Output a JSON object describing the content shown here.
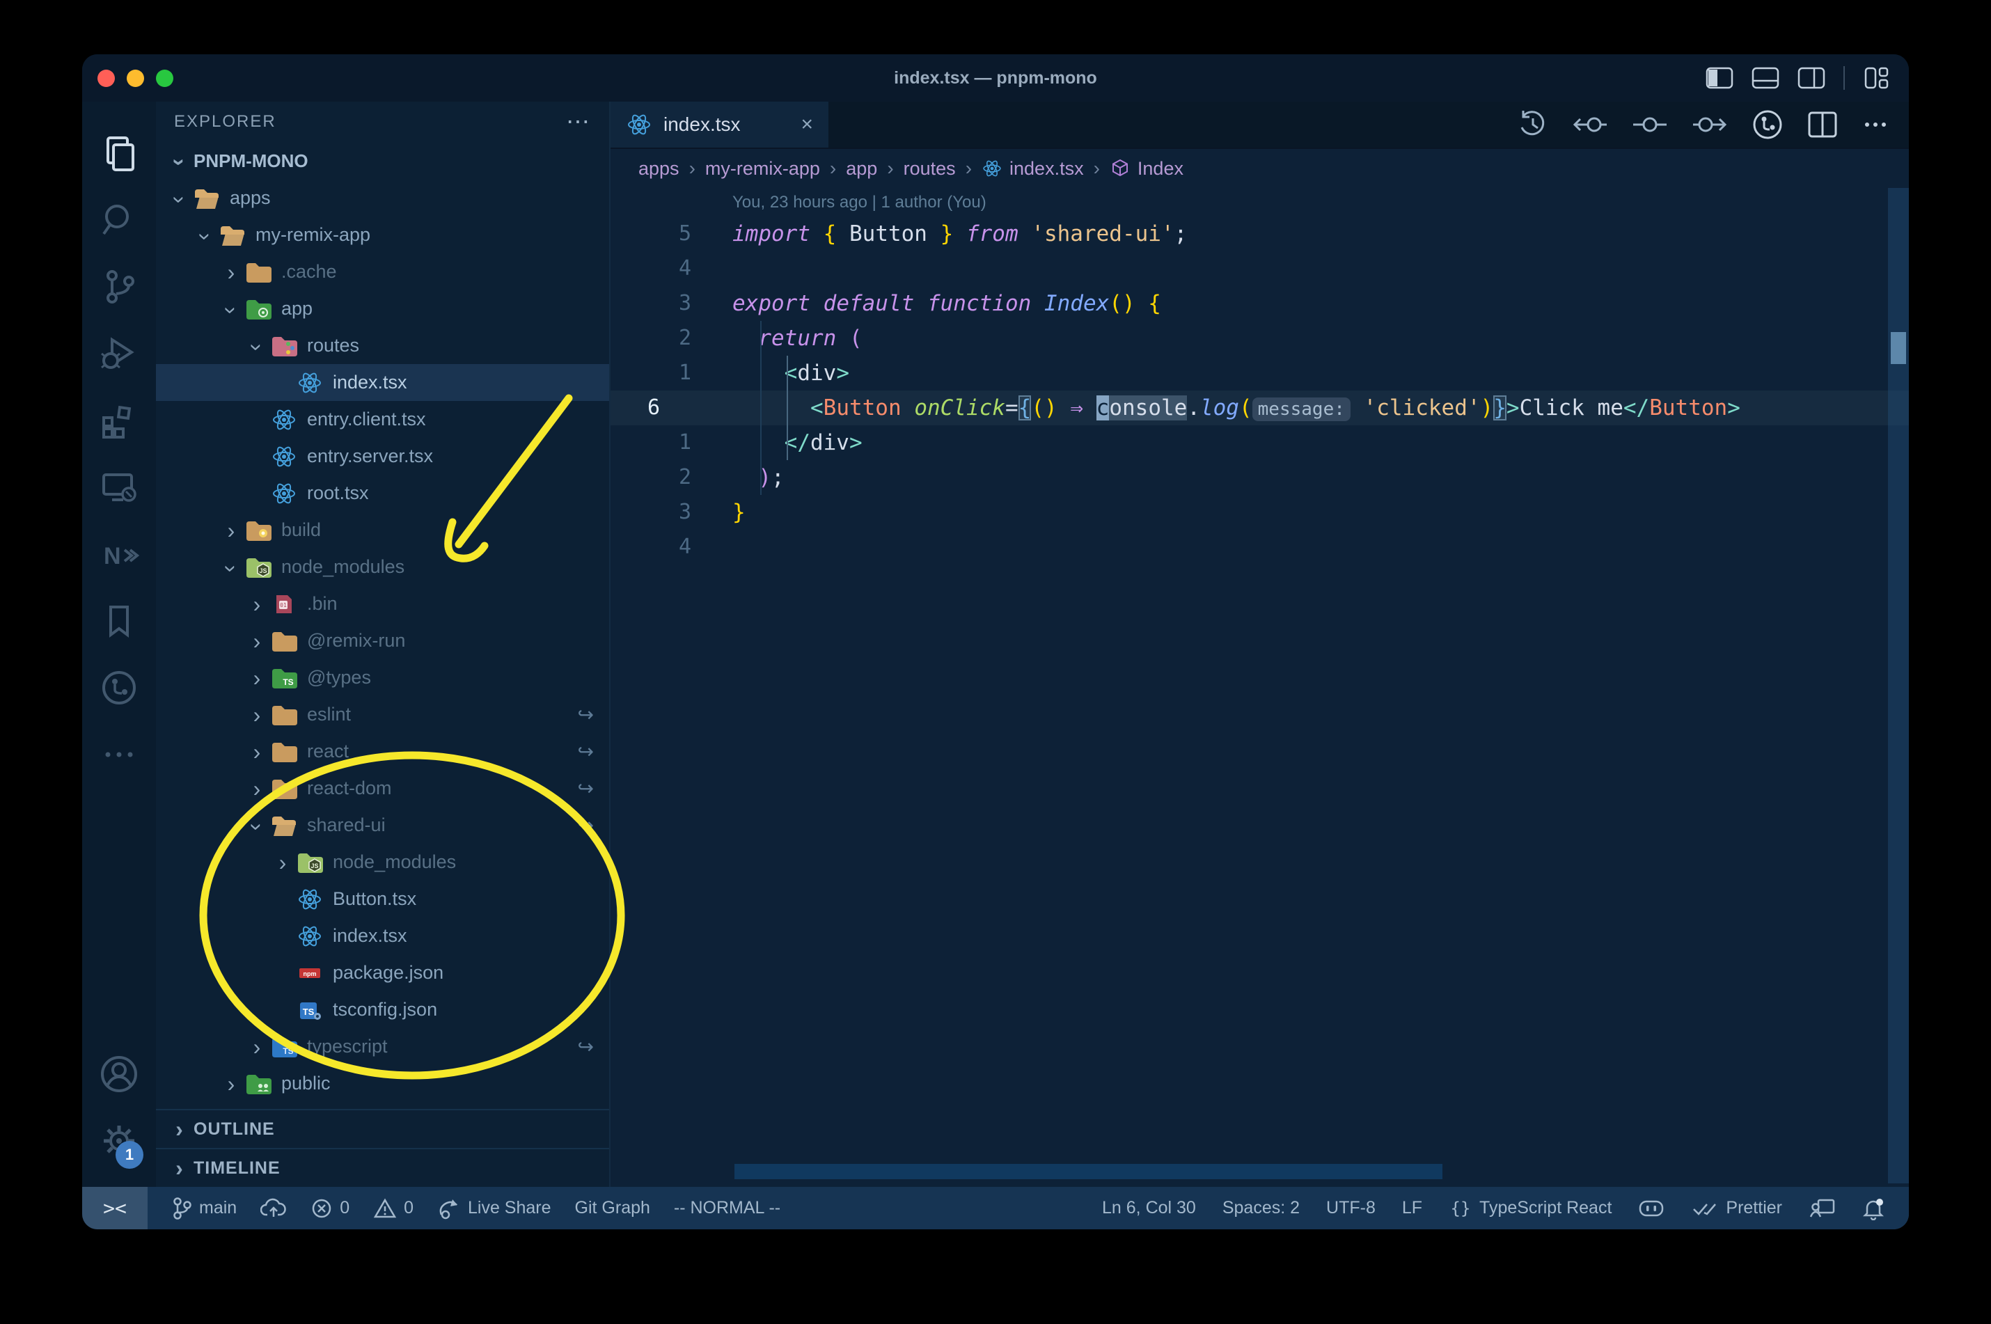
{
  "window": {
    "title": "index.tsx — pnpm-mono"
  },
  "colors": {
    "traffic_red": "#ff5f57",
    "traffic_yellow": "#febc2e",
    "traffic_green": "#28c840",
    "annotation_yellow": "#f6e82b",
    "accent_blue": "#3f7bc0",
    "editor_bg": "#0d2137",
    "status_bg": "#163453"
  },
  "titlebar_icons": [
    "layout-sidebar-icon",
    "layout-panel-icon",
    "layout-sidebar-right-icon",
    "divider",
    "layout-customize-icon"
  ],
  "activity_bar": {
    "icons": [
      {
        "name": "explorer-icon",
        "active": true
      },
      {
        "name": "search-icon",
        "active": false
      },
      {
        "name": "source-control-icon",
        "active": false
      },
      {
        "name": "run-debug-icon",
        "active": false
      },
      {
        "name": "extensions-icon",
        "active": false
      },
      {
        "name": "remote-explorer-icon",
        "active": false
      },
      {
        "name": "nx-console-icon",
        "active": false
      },
      {
        "name": "bookmarks-icon",
        "active": false
      },
      {
        "name": "git-graph-icon",
        "active": false
      },
      {
        "name": "more-views-icon",
        "active": false
      }
    ],
    "bottom_icons": [
      {
        "name": "account-icon",
        "badge": ""
      },
      {
        "name": "settings-gear-icon",
        "badge": "1"
      }
    ]
  },
  "explorer": {
    "header": "EXPLORER",
    "root": "PNPM-MONO",
    "items": [
      {
        "label": "apps",
        "level": 1,
        "icon": "folder-open",
        "chevron": "open",
        "dim": false,
        "selected": false,
        "symlink": false
      },
      {
        "label": "my-remix-app",
        "level": 2,
        "icon": "folder-open",
        "chevron": "open",
        "dim": false,
        "selected": false,
        "symlink": false
      },
      {
        "label": ".cache",
        "level": 3,
        "icon": "folder",
        "chevron": "closed",
        "dim": true,
        "selected": false,
        "symlink": false
      },
      {
        "label": "app",
        "level": 3,
        "icon": "folder-app",
        "chevron": "open",
        "dim": false,
        "selected": false,
        "symlink": false
      },
      {
        "label": "routes",
        "level": 4,
        "icon": "folder-routes",
        "chevron": "open",
        "dim": false,
        "selected": false,
        "symlink": false
      },
      {
        "label": "index.tsx",
        "level": 5,
        "icon": "react",
        "chevron": "none",
        "dim": false,
        "selected": true,
        "symlink": false
      },
      {
        "label": "entry.client.tsx",
        "level": 4,
        "icon": "react",
        "chevron": "none",
        "dim": false,
        "selected": false,
        "symlink": false
      },
      {
        "label": "entry.server.tsx",
        "level": 4,
        "icon": "react",
        "chevron": "none",
        "dim": false,
        "selected": false,
        "symlink": false
      },
      {
        "label": "root.tsx",
        "level": 4,
        "icon": "react",
        "chevron": "none",
        "dim": false,
        "selected": false,
        "symlink": false
      },
      {
        "label": "build",
        "level": 3,
        "icon": "folder-build",
        "chevron": "closed",
        "dim": true,
        "selected": false,
        "symlink": false
      },
      {
        "label": "node_modules",
        "level": 3,
        "icon": "folder-node",
        "chevron": "open",
        "dim": true,
        "selected": false,
        "symlink": false
      },
      {
        "label": ".bin",
        "level": 4,
        "icon": "file-bin",
        "chevron": "closed",
        "dim": true,
        "selected": false,
        "symlink": false
      },
      {
        "label": "@remix-run",
        "level": 4,
        "icon": "folder",
        "chevron": "closed",
        "dim": true,
        "selected": false,
        "symlink": false
      },
      {
        "label": "@types",
        "level": 4,
        "icon": "folder-types",
        "chevron": "closed",
        "dim": true,
        "selected": false,
        "symlink": false
      },
      {
        "label": "eslint",
        "level": 4,
        "icon": "folder",
        "chevron": "closed",
        "dim": true,
        "selected": false,
        "symlink": true
      },
      {
        "label": "react",
        "level": 4,
        "icon": "folder",
        "chevron": "closed",
        "dim": true,
        "selected": false,
        "symlink": true
      },
      {
        "label": "react-dom",
        "level": 4,
        "icon": "folder",
        "chevron": "closed",
        "dim": true,
        "selected": false,
        "symlink": true
      },
      {
        "label": "shared-ui",
        "level": 4,
        "icon": "folder-open",
        "chevron": "open",
        "dim": true,
        "selected": false,
        "symlink": true
      },
      {
        "label": "node_modules",
        "level": 5,
        "icon": "folder-node",
        "chevron": "closed",
        "dim": true,
        "selected": false,
        "symlink": false
      },
      {
        "label": "Button.tsx",
        "level": 5,
        "icon": "react",
        "chevron": "none",
        "dim": false,
        "selected": false,
        "symlink": false
      },
      {
        "label": "index.tsx",
        "level": 5,
        "icon": "react",
        "chevron": "none",
        "dim": false,
        "selected": false,
        "symlink": false
      },
      {
        "label": "package.json",
        "level": 5,
        "icon": "npm",
        "chevron": "none",
        "dim": false,
        "selected": false,
        "symlink": false
      },
      {
        "label": "tsconfig.json",
        "level": 5,
        "icon": "tsconfig",
        "chevron": "none",
        "dim": false,
        "selected": false,
        "symlink": false
      },
      {
        "label": "typescript",
        "level": 4,
        "icon": "folder-ts",
        "chevron": "closed",
        "dim": true,
        "selected": false,
        "symlink": true
      },
      {
        "label": "public",
        "level": 3,
        "icon": "folder-public",
        "chevron": "closed",
        "dim": false,
        "selected": false,
        "symlink": false
      }
    ],
    "sections": [
      "OUTLINE",
      "TIMELINE"
    ]
  },
  "tab": {
    "label": "index.tsx",
    "icon": "react",
    "close": "×"
  },
  "editor_actions": [
    "history-icon",
    "prev-change-icon",
    "compare-icon",
    "next-change-icon",
    "file-history-icon",
    "split-editor-icon",
    "more-actions-icon"
  ],
  "breadcrumbs": [
    {
      "label": "apps",
      "icon": ""
    },
    {
      "label": "my-remix-app",
      "icon": ""
    },
    {
      "label": "app",
      "icon": ""
    },
    {
      "label": "routes",
      "icon": ""
    },
    {
      "label": "index.tsx",
      "icon": "react"
    },
    {
      "label": "Index",
      "icon": "symbol-cube"
    }
  ],
  "editor": {
    "codelens": "You, 23 hours ago | 1 author (You)",
    "gutter": [
      "5",
      "4",
      "3",
      "2",
      "1",
      "6",
      "1",
      "2",
      "3",
      "4"
    ],
    "current_line_index": 5,
    "lines": [
      [
        {
          "c": "kw",
          "t": "import"
        },
        {
          "c": "plain",
          "t": " "
        },
        {
          "c": "gold",
          "t": "{"
        },
        {
          "c": "plain",
          "t": " Button "
        },
        {
          "c": "gold",
          "t": "}"
        },
        {
          "c": "plain",
          "t": " "
        },
        {
          "c": "kw",
          "t": "from"
        },
        {
          "c": "plain",
          "t": " "
        },
        {
          "c": "str",
          "t": "'shared-ui'"
        },
        {
          "c": "plain",
          "t": ";"
        }
      ],
      [],
      [
        {
          "c": "kw",
          "t": "export"
        },
        {
          "c": "plain",
          "t": " "
        },
        {
          "c": "kw",
          "t": "default"
        },
        {
          "c": "plain",
          "t": " "
        },
        {
          "c": "kw",
          "t": "function"
        },
        {
          "c": "plain",
          "t": " "
        },
        {
          "c": "fn",
          "t": "Index"
        },
        {
          "c": "gold",
          "t": "()"
        },
        {
          "c": "plain",
          "t": " "
        },
        {
          "c": "gold",
          "t": "{"
        }
      ],
      [
        {
          "c": "plain",
          "t": "  "
        },
        {
          "c": "kw",
          "t": "return"
        },
        {
          "c": "plain",
          "t": " "
        },
        {
          "c": "pink",
          "t": "("
        }
      ],
      [
        {
          "c": "plain",
          "t": "    "
        },
        {
          "c": "tag",
          "t": "<"
        },
        {
          "c": "plain",
          "t": "div"
        },
        {
          "c": "tag",
          "t": ">"
        }
      ],
      [
        {
          "c": "plain",
          "t": "      "
        },
        {
          "c": "tag",
          "t": "<"
        },
        {
          "c": "comp",
          "t": "Button"
        },
        {
          "c": "plain",
          "t": " "
        },
        {
          "c": "attr",
          "t": "onClick"
        },
        {
          "c": "plain",
          "t": "="
        },
        {
          "c": "brkt",
          "t": "{"
        },
        {
          "c": "gold",
          "t": "()"
        },
        {
          "c": "plain",
          "t": " "
        },
        {
          "c": "op",
          "t": "⇒"
        },
        {
          "c": "plain",
          "t": " "
        },
        {
          "c": "cursor",
          "t": "c"
        },
        {
          "c": "wordhl",
          "t": "onsole"
        },
        {
          "c": "plain",
          "t": "."
        },
        {
          "c": "fn",
          "t": "log"
        },
        {
          "c": "gold",
          "t": "("
        },
        {
          "c": "inlay",
          "t": "message:"
        },
        {
          "c": "plain",
          "t": " "
        },
        {
          "c": "str",
          "t": "'clicked'"
        },
        {
          "c": "gold",
          "t": ")"
        },
        {
          "c": "brkt",
          "t": "}"
        },
        {
          "c": "tag",
          "t": ">"
        },
        {
          "c": "plain",
          "t": "Click me"
        },
        {
          "c": "tag",
          "t": "</"
        },
        {
          "c": "comp",
          "t": "Button"
        },
        {
          "c": "tag",
          "t": ">"
        }
      ],
      [
        {
          "c": "plain",
          "t": "    "
        },
        {
          "c": "tag",
          "t": "</"
        },
        {
          "c": "plain",
          "t": "div"
        },
        {
          "c": "tag",
          "t": ">"
        }
      ],
      [
        {
          "c": "plain",
          "t": "  "
        },
        {
          "c": "pink",
          "t": ")"
        },
        {
          "c": "plain",
          "t": ";"
        }
      ],
      [
        {
          "c": "gold",
          "t": "}"
        }
      ],
      []
    ]
  },
  "status_bar": {
    "left": [
      {
        "name": "remote-indicator",
        "icon": "remote",
        "text": "><"
      },
      {
        "name": "git-branch",
        "icon": "branch-icon",
        "text": "main"
      },
      {
        "name": "sync-publish",
        "icon": "cloud-upload-icon",
        "text": ""
      },
      {
        "name": "errors",
        "icon": "error-icon",
        "text": "0"
      },
      {
        "name": "warnings",
        "icon": "warning-icon",
        "text": "0"
      },
      {
        "name": "live-share",
        "icon": "live-share-icon",
        "text": "Live Share"
      },
      {
        "name": "git-graph",
        "icon": "",
        "text": "Git Graph"
      },
      {
        "name": "vim-mode",
        "icon": "",
        "text": "-- NORMAL --"
      }
    ],
    "right": [
      {
        "name": "cursor-position",
        "icon": "",
        "text": "Ln 6, Col 30"
      },
      {
        "name": "indentation",
        "icon": "",
        "text": "Spaces: 2"
      },
      {
        "name": "encoding",
        "icon": "",
        "text": "UTF-8"
      },
      {
        "name": "eol",
        "icon": "",
        "text": "LF"
      },
      {
        "name": "language-mode",
        "icon": "braces-icon",
        "text": "TypeScript React"
      },
      {
        "name": "copilot",
        "icon": "copilot-icon",
        "text": ""
      },
      {
        "name": "formatter",
        "icon": "double-check-icon",
        "text": "Prettier"
      },
      {
        "name": "feedback",
        "icon": "feedback-icon",
        "text": ""
      },
      {
        "name": "notifications",
        "icon": "bell-icon",
        "text": ""
      }
    ]
  },
  "annotations": {
    "color": "#f6e82b",
    "shapes": [
      "arrow-to-node-modules",
      "circle-around-shared-ui"
    ]
  }
}
